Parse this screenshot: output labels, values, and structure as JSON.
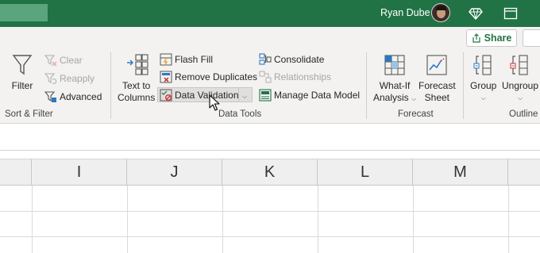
{
  "titlebar": {
    "user_name": "Ryan Dube",
    "accent_color": "#217346",
    "icons": [
      "avatar",
      "diamond-icon",
      "ribbon-display-icon"
    ]
  },
  "ribbon": {
    "share_label": "Share",
    "groups": {
      "sort_filter": {
        "label": "Sort & Filter",
        "filter_label": "Filter",
        "clear_label": "Clear",
        "reapply_label": "Reapply",
        "advanced_label": "Advanced"
      },
      "data_tools": {
        "label": "Data Tools",
        "text_to_columns_line1": "Text to",
        "text_to_columns_line2": "Columns",
        "flash_fill_label": "Flash Fill",
        "remove_duplicates_label": "Remove Duplicates",
        "data_validation_label": "Data Validation",
        "consolidate_label": "Consolidate",
        "relationships_label": "Relationships",
        "manage_data_model_label": "Manage Data Model"
      },
      "forecast": {
        "label": "Forecast",
        "what_if_line1": "What-If",
        "what_if_line2": "Analysis",
        "forecast_sheet_line1": "Forecast",
        "forecast_sheet_line2": "Sheet"
      },
      "outline": {
        "label": "Outline",
        "group_label": "Group",
        "ungroup_label": "Ungroup"
      }
    }
  },
  "sheet": {
    "columns": [
      "I",
      "J",
      "K",
      "L",
      "M"
    ]
  }
}
